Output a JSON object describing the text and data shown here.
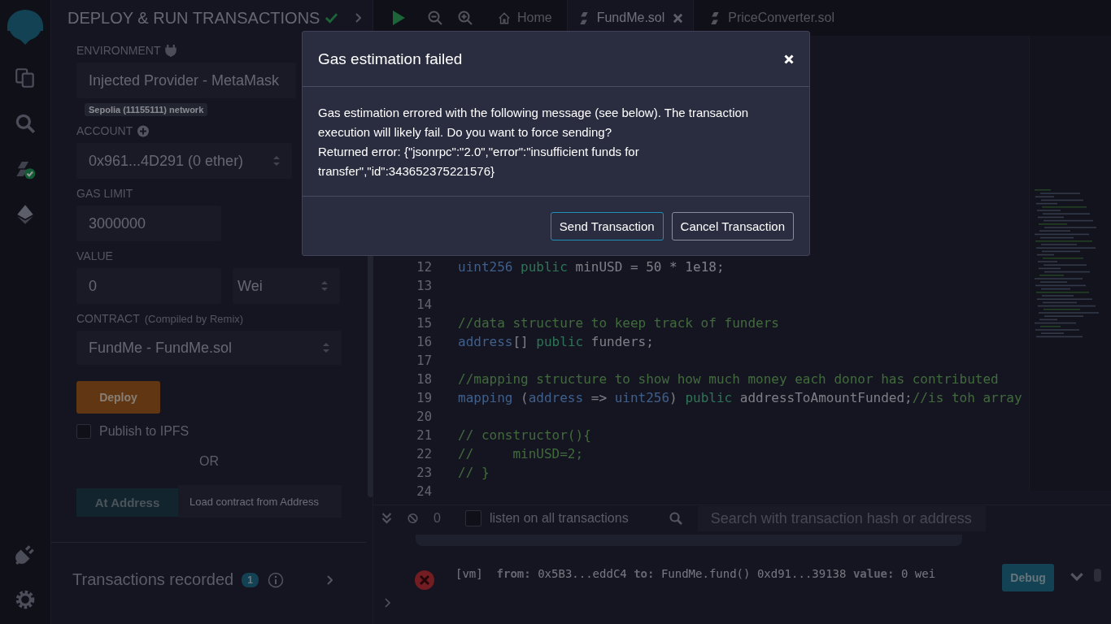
{
  "panel": {
    "title": "DEPLOY & RUN TRANSACTIONS",
    "title_ok": true,
    "environment": {
      "label": "ENVIRONMENT",
      "value": "Injected Provider - MetaMask",
      "network": "Sepolia (11155111) network"
    },
    "account": {
      "label": "ACCOUNT",
      "value": "0x961...4D291 (0 ether)"
    },
    "gas_limit": {
      "label": "GAS LIMIT",
      "value": "3000000"
    },
    "value": {
      "label": "VALUE",
      "amount": "0",
      "unit": "Wei"
    },
    "contract": {
      "label": "CONTRACT",
      "note": "(Compiled by Remix)",
      "value": "FundMe - FundMe.sol"
    },
    "deploy_button": "Deploy",
    "publish": {
      "label": "Publish to IPFS",
      "checked": false
    },
    "or_text": "OR",
    "at_address_button": "At Address",
    "at_address_field": {
      "placeholder": "Load contract from Address"
    },
    "transactions_recorded": {
      "label": "Transactions recorded",
      "count": "1"
    }
  },
  "tabs": [
    {
      "label": "Home",
      "kind": "home",
      "selected": false,
      "closable": false
    },
    {
      "label": "FundMe.sol",
      "kind": "file",
      "selected": true,
      "closable": true
    },
    {
      "label": "PriceConverter.sol",
      "kind": "file",
      "selected": false,
      "closable": false
    }
  ],
  "editor": {
    "lines": [
      {
        "number": "12",
        "tokens": [
          {
            "kind": "type",
            "text": "uint256"
          },
          {
            "kind": "keyword",
            "text": " public"
          },
          {
            "kind": "plain",
            "text": " minUSD = 50 * 1e18;"
          }
        ]
      },
      {
        "number": "13"
      },
      {
        "number": "14"
      },
      {
        "number": "15",
        "tokens": [
          {
            "kind": "comment",
            "text": "//data structure to keep track of funders"
          }
        ]
      },
      {
        "number": "16",
        "tokens": [
          {
            "kind": "type",
            "text": "address"
          },
          {
            "kind": "plain",
            "text": "[] "
          },
          {
            "kind": "keyword",
            "text": "public"
          },
          {
            "kind": "plain",
            "text": " funders;"
          }
        ]
      },
      {
        "number": "17"
      },
      {
        "number": "18",
        "tokens": [
          {
            "kind": "comment",
            "text": "//mapping structure to show how much money each donor has contributed"
          }
        ]
      },
      {
        "number": "19",
        "tokens": [
          {
            "kind": "type",
            "text": "mapping"
          },
          {
            "kind": "plain",
            "text": " ("
          },
          {
            "kind": "type",
            "text": "address"
          },
          {
            "kind": "plain",
            "text": " => "
          },
          {
            "kind": "type",
            "text": "uint256"
          },
          {
            "kind": "plain",
            "text": ") "
          },
          {
            "kind": "keyword",
            "text": "public"
          },
          {
            "kind": "plain",
            "text": " addressToAmountFunded;"
          },
          {
            "kind": "comment",
            "text": "//is toh array"
          }
        ]
      },
      {
        "number": "20"
      },
      {
        "number": "21",
        "tokens": [
          {
            "kind": "comment",
            "text": "// constructor(){"
          }
        ]
      },
      {
        "number": "22",
        "tokens": [
          {
            "kind": "comment",
            "text": "//     minUSD=2;"
          }
        ]
      },
      {
        "number": "23",
        "tokens": [
          {
            "kind": "comment",
            "text": "// }"
          }
        ]
      },
      {
        "number": "24"
      }
    ]
  },
  "terminal": {
    "count": "0",
    "listen": {
      "label": "listen on all transactions",
      "checked": false
    },
    "search": {
      "placeholder": "Search with transaction hash or address"
    },
    "log": {
      "text": "[vm]  **from:** 0x5B3...eddC4 **to:** FundMe.fund() 0xd91...39138 **value:** 0 wei",
      "button": "Debug"
    }
  },
  "modal": {
    "title": "Gas estimation failed",
    "message": [
      "Gas estimation errored with the following message (see below). The transaction execution will likely fail. Do you want to force sending?",
      "Returned error: {\"jsonrpc\":\"2.0\",\"error\":\"insufficient funds for transfer\",\"id\":343652375221576}"
    ],
    "buttons": [
      {
        "label": "Send Transaction",
        "primary": true
      },
      {
        "label": "Cancel Transaction",
        "primary": false
      }
    ]
  }
}
